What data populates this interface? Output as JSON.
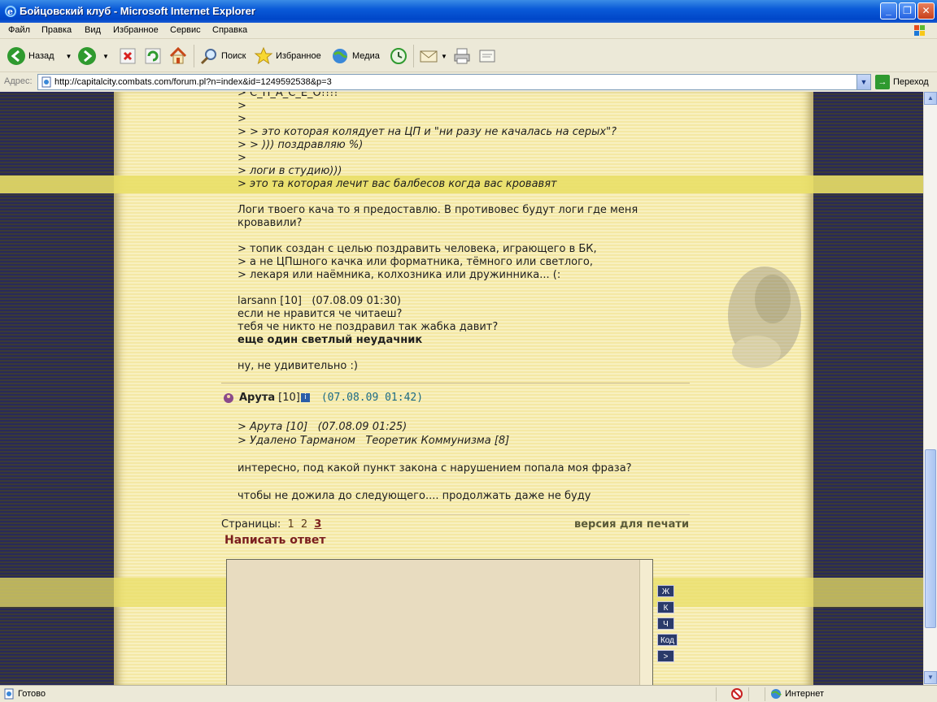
{
  "window": {
    "title": "Бойцовский клуб - Microsoft Internet Explorer",
    "min_glyph": "_",
    "max_glyph": "❐",
    "close_glyph": "✕"
  },
  "menu": [
    "Файл",
    "Правка",
    "Вид",
    "Избранное",
    "Сервис",
    "Справка"
  ],
  "toolbar": {
    "back": "Назад",
    "search": "Поиск",
    "favorites": "Избранное",
    "media": "Медиа"
  },
  "address": {
    "label": "Адрес:",
    "url": "http://capitalcity.combats.com/forum.pl?n=index&id=1249592538&p=3",
    "go": "Переход",
    "drop_glyph": "▼",
    "go_glyph": "→"
  },
  "post1": {
    "lines": [
      {
        "text": "> С_П_А_С_Е_О!!!!",
        "style": "plain"
      },
      {
        "text": ">",
        "style": "plain"
      },
      {
        "text": ">",
        "style": "plain"
      },
      {
        "text": "> > это которая колядует на ЦП и \"ни разу не качалась на серых\"?",
        "style": "quote"
      },
      {
        "text": "> > ))) поздравляю %)",
        "style": "quote"
      },
      {
        "text": ">",
        "style": "plain"
      },
      {
        "text": "> логи в студию)))",
        "style": "quote"
      },
      {
        "text": "> это та которая лечит вас балбесов когда вас кровавят",
        "style": "quote"
      },
      {
        "text": "",
        "style": "plain"
      },
      {
        "text": "Логи твоего кача то я предоставлю. В противовес будут логи где меня",
        "style": "plain"
      },
      {
        "text": "кровавили?",
        "style": "plain"
      },
      {
        "text": "",
        "style": "plain"
      },
      {
        "text": "> топик создан с целью поздравить человека, играющего в БК,",
        "style": "plain"
      },
      {
        "text": "> а не ЦПшного качка или форматника, тёмного или светлого,",
        "style": "plain"
      },
      {
        "text": "> лекаря или наёмника, колхозника или дружинника... (:",
        "style": "plain"
      },
      {
        "text": "",
        "style": "plain"
      },
      {
        "text": "larsann [10]   (07.08.09 01:30)",
        "style": "plain"
      },
      {
        "text": "если не нравится че читаеш?",
        "style": "plain"
      },
      {
        "text": "тебя че никто не поздравил так жабка давит?",
        "style": "plain"
      },
      {
        "text": "еще один светлый неудачник",
        "style": "bold"
      },
      {
        "text": "",
        "style": "plain"
      },
      {
        "text": "ну, не удивительно :)",
        "style": "plain"
      }
    ]
  },
  "post2": {
    "author": "Арута",
    "level": "[10]",
    "info_glyph": "i",
    "date": "(07.08.09 01:42)",
    "lines": [
      {
        "text": "> Арута [10]   (07.08.09 01:25)",
        "style": "quote"
      },
      {
        "text": "> Удалено Тарманом   Теоретик Коммунизма [8]",
        "style": "quote"
      },
      {
        "text": "",
        "style": "plain"
      },
      {
        "text": "интересно, под какой пункт закона с нарушением попала моя фраза?",
        "style": "plain"
      },
      {
        "text": "",
        "style": "plain"
      },
      {
        "text": "чтобы не дожила до следующего.... продолжать даже не буду",
        "style": "plain"
      }
    ]
  },
  "pager": {
    "label": "Страницы:",
    "pages": [
      "1",
      "2",
      "3"
    ],
    "current": "3",
    "print_version": "версия для печати"
  },
  "reply": {
    "title": "Написать ответ",
    "buttons": [
      "Ж",
      "К",
      "Ч",
      "Код",
      ">"
    ]
  },
  "scroll": {
    "up_glyph": "▲",
    "down_glyph": "▼"
  },
  "status": {
    "text": "Готово",
    "zone": "Интернет"
  },
  "colors": {
    "titlebar": "#0a5ad8",
    "paper": "#f6ecb4",
    "accent_red": "#7a1e1e",
    "date_teal": "#1b6a84"
  }
}
